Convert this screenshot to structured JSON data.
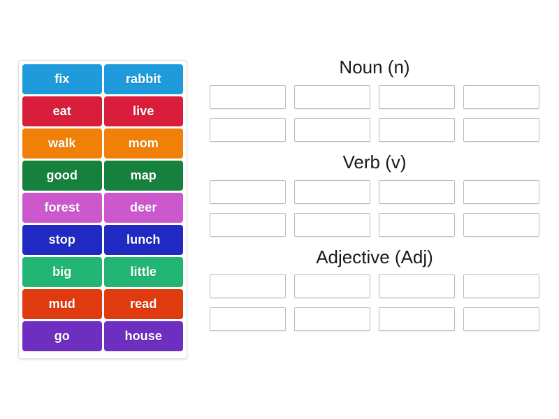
{
  "page": {
    "background_color": "#ffffff",
    "activity_type": "word-sort-drag-and-drop"
  },
  "word_bank": {
    "name": "word-bank",
    "border_color": "#e2e2e2",
    "rows": [
      {
        "color": "#1F9BDC",
        "tiles": [
          {
            "label": "fix"
          },
          {
            "label": "rabbit"
          }
        ]
      },
      {
        "color": "#D91E3C",
        "tiles": [
          {
            "label": "eat"
          },
          {
            "label": "live"
          }
        ]
      },
      {
        "color": "#F08007",
        "tiles": [
          {
            "label": "walk"
          },
          {
            "label": "mom"
          }
        ]
      },
      {
        "color": "#16813D",
        "tiles": [
          {
            "label": "good"
          },
          {
            "label": "map"
          }
        ]
      },
      {
        "color": "#CC58CE",
        "tiles": [
          {
            "label": "forest"
          },
          {
            "label": "deer"
          }
        ]
      },
      {
        "color": "#2029C1",
        "tiles": [
          {
            "label": "stop"
          },
          {
            "label": "lunch"
          }
        ]
      },
      {
        "color": "#22B573",
        "tiles": [
          {
            "label": "big"
          },
          {
            "label": "little"
          }
        ]
      },
      {
        "color": "#E03A0F",
        "tiles": [
          {
            "label": "mud"
          },
          {
            "label": "read"
          }
        ]
      },
      {
        "color": "#6E2EBF",
        "tiles": [
          {
            "label": "go"
          },
          {
            "label": "house"
          }
        ]
      }
    ]
  },
  "categories": [
    {
      "title": "Noun (n)",
      "slot_rows": [
        [
          {
            "value": ""
          },
          {
            "value": ""
          },
          {
            "value": ""
          },
          {
            "value": ""
          }
        ],
        [
          {
            "value": ""
          },
          {
            "value": ""
          },
          {
            "value": ""
          },
          {
            "value": ""
          }
        ]
      ]
    },
    {
      "title": "Verb (v)",
      "slot_rows": [
        [
          {
            "value": ""
          },
          {
            "value": ""
          },
          {
            "value": ""
          },
          {
            "value": ""
          }
        ],
        [
          {
            "value": ""
          },
          {
            "value": ""
          },
          {
            "value": ""
          },
          {
            "value": ""
          }
        ]
      ]
    },
    {
      "title": "Adjective (Adj)",
      "slot_rows": [
        [
          {
            "value": ""
          },
          {
            "value": ""
          },
          {
            "value": ""
          },
          {
            "value": ""
          }
        ],
        [
          {
            "value": ""
          },
          {
            "value": ""
          },
          {
            "value": ""
          },
          {
            "value": ""
          }
        ]
      ]
    }
  ],
  "slot_style": {
    "border_color": "#bcbcbc",
    "background_color": "#ffffff"
  }
}
